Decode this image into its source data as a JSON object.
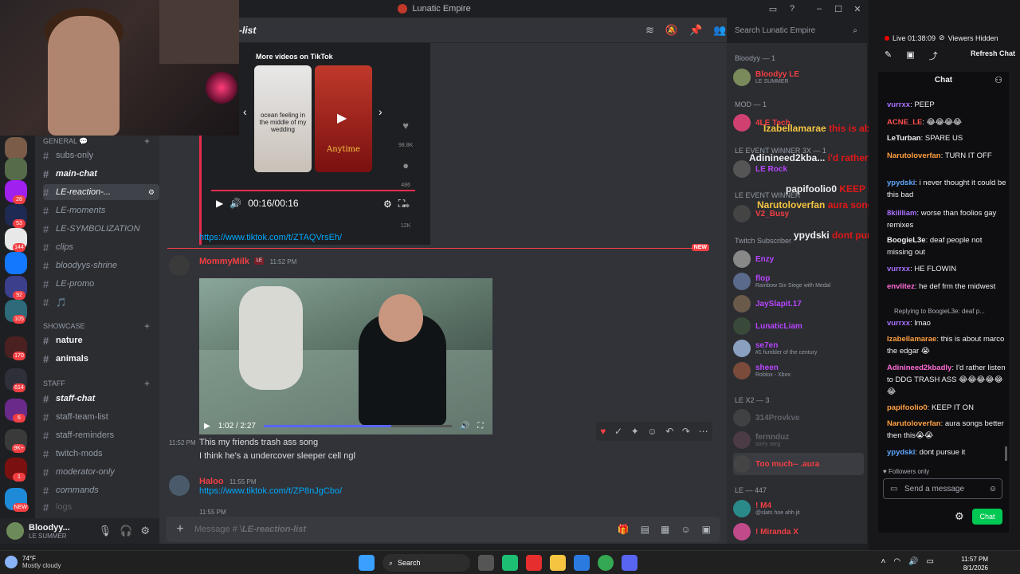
{
  "window": {
    "title": "Lunatic Empire"
  },
  "channel_header": {
    "name": "-list",
    "search_placeholder": "Search Lunatic Empire"
  },
  "channels": {
    "category_general": "general 💬",
    "items": [
      {
        "label": "subs-only"
      },
      {
        "label": "main-chat"
      },
      {
        "label": "LE-reaction-..."
      },
      {
        "label": "LE-moments"
      },
      {
        "label": "LE-SYMBOLIZATION"
      },
      {
        "label": "clips"
      },
      {
        "label": "bloodyys-shrine"
      },
      {
        "label": "LE-promo"
      },
      {
        "label": "🎵"
      }
    ],
    "category_showcase": "SHOWCASE",
    "showcase_items": [
      {
        "label": "nature"
      },
      {
        "label": "animals"
      }
    ],
    "category_staff": "staff",
    "staff_items": [
      {
        "label": "staff-chat"
      },
      {
        "label": "staff-team-list"
      },
      {
        "label": "staff-reminders"
      },
      {
        "label": "twitch-mods"
      },
      {
        "label": "moderator-only"
      },
      {
        "label": "commands"
      },
      {
        "label": "logs"
      }
    ]
  },
  "server_badges": [
    "28",
    "53",
    "144",
    "92",
    "105",
    "170",
    "614",
    "6",
    "9K+",
    "1",
    "NEW"
  ],
  "user_panel": {
    "name": "Bloodyy...",
    "status": "LE SUMMER"
  },
  "tiktok": {
    "more_videos": "More videos on TikTok",
    "thumb1_caption": "ocean feeling in the middle of my wedding",
    "thumb2_caption": "Anytime",
    "likes": "98.8K",
    "comments": "486",
    "shares": "12K",
    "time": "00:16/00:16",
    "link": "https://www.tiktok.com/t/ZTAQVrsEh/"
  },
  "new_badge": "NEW",
  "messages": [
    {
      "author": "MommyMilk",
      "time": "11:52 PM",
      "video_time": "1:02 / 2:27",
      "video_progress": 0.68
    },
    {
      "time_left": "11:52 PM",
      "text": "This my friends trash ass song"
    },
    {
      "text": "I think he's a undercover sleeper cell ngl"
    },
    {
      "author": "Haloo",
      "time": "11:55 PM",
      "link": "https://www.tiktok.com/t/ZP8nJgCbo/"
    },
    {
      "time": "11:55 PM"
    }
  ],
  "composer": {
    "prefix": "Message # \\",
    "channel": "LE-reaction-list"
  },
  "members": {
    "groups": [
      {
        "title": "Bloodyy — 1"
      },
      {
        "title": "MOD — 1"
      },
      {
        "title": "LE EVENT WINNER 3X — 1"
      },
      {
        "title": "LE EVENT WINNER"
      },
      {
        "title": "Twitch Subscriber"
      },
      {
        "title": "LE X2 — 3"
      },
      {
        "title": "LE — 447"
      }
    ],
    "list": [
      {
        "name": "Bloodyy LE",
        "status": "LE SUMMER",
        "color": "#f23f43"
      },
      {
        "name": "4LE Tech",
        "status": "",
        "color": "#f23f43"
      },
      {
        "name": "LE Rock",
        "status": "",
        "color": "#b845ff"
      },
      {
        "name": "V2_Busy",
        "status": "",
        "color": "#f23f43"
      },
      {
        "name": "Enzy",
        "status": "",
        "color": "#b845ff"
      },
      {
        "name": "flop",
        "status": "Rainbow Six Siege with Medal",
        "color": "#b845ff"
      },
      {
        "name": "JaySlapit.17",
        "status": "",
        "color": "#b845ff"
      },
      {
        "name": "LunaticLiam",
        "status": "",
        "color": "#b845ff"
      },
      {
        "name": "se7en",
        "status": "#1 fumbler of the century",
        "color": "#b845ff"
      },
      {
        "name": "sheen",
        "status": "Roblox - Xbox",
        "color": "#b845ff"
      },
      {
        "name": "314Provkve",
        "status": "",
        "color": "#949ba4"
      },
      {
        "name": "fernnduz",
        "status": "sorry serg",
        "color": "#949ba4"
      },
      {
        "name": "Too much-- .aura",
        "status": "",
        "color": "#f23f43"
      },
      {
        "name": "! M4",
        "status": "@slats hoe ahh jit",
        "color": "#f23f43"
      },
      {
        "name": "! Miranda X",
        "status": "",
        "color": "#f23f43"
      }
    ]
  },
  "overlay": [
    {
      "user": "Izabellamarae",
      "text": "this is about marco the edgar"
    },
    {
      "user": "Adinineed2kba...",
      "text": "i'd rather listen to DDG TRASH ASS"
    },
    {
      "user": "papifoolio0",
      "text": "KEEP IT ON"
    },
    {
      "user": "Narutoloverfan",
      "text": "aura songs better then this"
    },
    {
      "user": "ypydski",
      "text": "dont pursue it"
    }
  ],
  "stream": {
    "live": "Live 01:38:09",
    "viewers": "Viewers Hidden",
    "refresh": "Refresh Chat",
    "chat_title": "Chat",
    "followers_only": "Followers only",
    "send_placeholder": "Send a message",
    "chat_button": "Chat",
    "reply_context": "Replying to BoogieL3e: deaf p...",
    "lines": [
      {
        "user": "vurrxx",
        "text": "PEEP",
        "color": "#a970ff"
      },
      {
        "user": "ACNE_LE",
        "text": "😂😂😂😂",
        "color": "#ff4f4f"
      },
      {
        "user": "LeTurban",
        "text": "SPARE US",
        "color": "#efeff1"
      },
      {
        "user": "Narutoloverfan",
        "text": "TURN IT OFF",
        "color": "#ff9f40"
      },
      {
        "user": "ypydski",
        "text": "i never thought it could be this bad",
        "color": "#5fa8ff"
      },
      {
        "user": "8kiilliam",
        "text": "worse than foolios gay remixes",
        "color": "#a970ff"
      },
      {
        "user": "BoogieL3e",
        "text": "deaf people not missing out",
        "color": "#efeff1"
      },
      {
        "user": "vurrxx",
        "text": "HE FLOWIN",
        "color": "#a970ff"
      },
      {
        "user": "envlitez",
        "text": "he def frm the midwest",
        "color": "#ff6bd6"
      },
      {
        "user": "vurrxx",
        "text": "lmao",
        "color": "#a970ff"
      },
      {
        "user": "Izabellamarae",
        "text": "this is about marco the edgar 😭",
        "color": "#ff9f40"
      },
      {
        "user": "Adinineed2kbadly",
        "text": "I'd rather listen to DDG TRASH ASS 😂😂😂😂😂😂",
        "color": "#ff6bd6"
      },
      {
        "user": "papifoolio0",
        "text": "KEEP IT ON",
        "color": "#ff9f40"
      },
      {
        "user": "Narutoloverfan",
        "text": "aura songs better then this😭😭",
        "color": "#ff9f40"
      },
      {
        "user": "ypydski",
        "text": "dont pursue it",
        "color": "#5fa8ff"
      }
    ]
  },
  "taskbar": {
    "temp": "74°F",
    "weather": "Mostly cloudy",
    "search": "Search",
    "time": "11:57 PM",
    "date": "8/1/2026"
  }
}
